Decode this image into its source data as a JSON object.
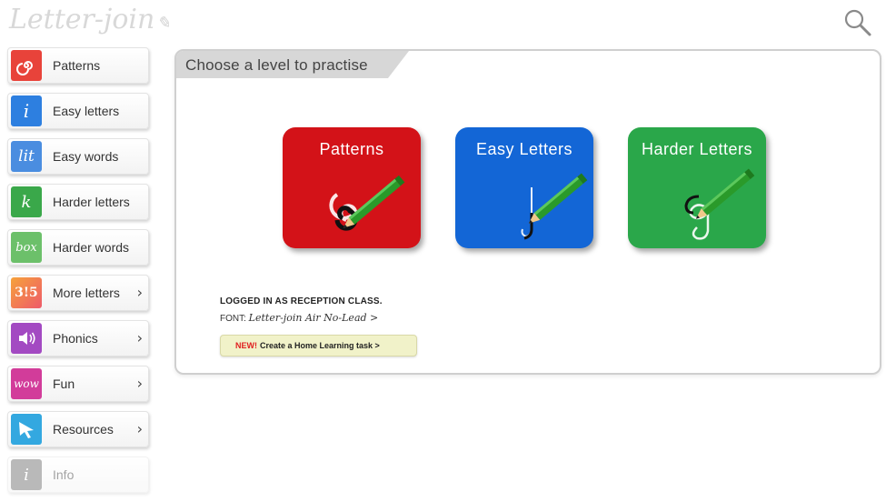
{
  "header": {
    "logo_text": "Letter-join",
    "search_icon": "search-icon"
  },
  "sidebar": {
    "items": [
      {
        "label": "Patterns",
        "icon": "patterns-icon",
        "icon_glyph": "ᘐ",
        "color": "#e8433a",
        "chevron": false
      },
      {
        "label": "Easy letters",
        "icon": "easy-letters-icon",
        "icon_glyph": "i",
        "color": "#2d7fe0",
        "chevron": false
      },
      {
        "label": "Easy words",
        "icon": "easy-words-icon",
        "icon_glyph": "lit",
        "color": "#4a8de0",
        "chevron": false
      },
      {
        "label": "Harder letters",
        "icon": "harder-letters-icon",
        "icon_glyph": "k",
        "color": "#3aa84a",
        "chevron": false
      },
      {
        "label": "Harder words",
        "icon": "harder-words-icon",
        "icon_glyph": "box",
        "color": "#6cc06a",
        "chevron": false
      },
      {
        "label": "More letters",
        "icon": "more-letters-icon",
        "icon_glyph": "3!5",
        "color": "#f07a2a",
        "chevron": true
      },
      {
        "label": "Phonics",
        "icon": "speaker-icon",
        "icon_glyph": "🔊",
        "color": "#a34ac2",
        "chevron": true
      },
      {
        "label": "Fun",
        "icon": "fun-icon",
        "icon_glyph": "wow",
        "color": "#d23c9a",
        "chevron": true
      },
      {
        "label": "Resources",
        "icon": "resources-icon",
        "icon_glyph": "➤",
        "color": "#33a8e0",
        "chevron": true
      },
      {
        "label": "Info",
        "icon": "info-icon",
        "icon_glyph": "i",
        "color": "#666666",
        "chevron": false
      }
    ]
  },
  "main": {
    "title": "Choose a level to practise",
    "levels": [
      {
        "label": "Patterns",
        "color": "#d31218"
      },
      {
        "label": "Easy Letters",
        "color": "#1366d6"
      },
      {
        "label": "Harder Letters",
        "color": "#2aa74a"
      }
    ],
    "logged_in": "LOGGED IN AS RECEPTION CLASS.",
    "font_prefix": "FONT:",
    "font_value": "Letter-join Air No-Lead >",
    "task_new": "NEW!",
    "task_label": "Create a Home Learning task >"
  }
}
